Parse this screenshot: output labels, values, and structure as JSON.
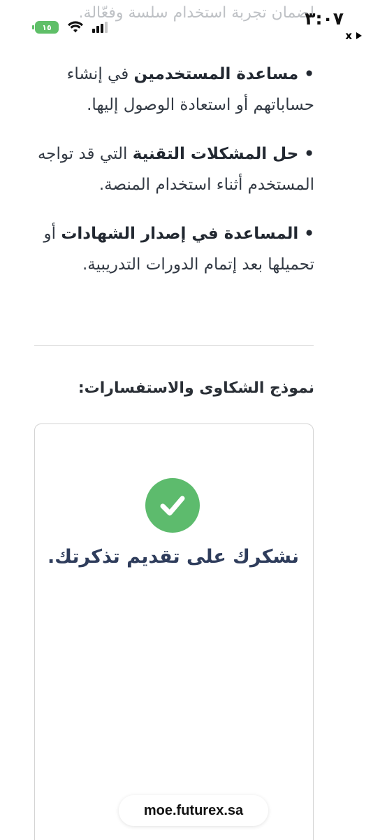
{
  "status_bar": {
    "time": "٣:٠٧",
    "battery": "١٥"
  },
  "overlay": {
    "close_label": "x"
  },
  "top_partial_text": "لضمان تجربة استخدام سلسة وفعّالة.",
  "bullets": [
    {
      "bold": "• مساعدة المستخدمين",
      "rest": " في إنشاء حساباتهم أو استعادة الوصول إليها."
    },
    {
      "bold": "• حل المشكلات التقنية",
      "rest": " التي قد تواجه المستخدم أثناء استخدام المنصة."
    },
    {
      "bold": "• المساعدة في إصدار الشهادات",
      "rest": " أو تحميلها بعد إتمام الدورات التدريبية."
    }
  ],
  "form": {
    "heading": "نموذج الشكاوى والاستفسارات:",
    "success_message": "نشكرك على تقديم تذكرتك."
  },
  "url_bar": {
    "domain": "moe.futurex.sa"
  },
  "colors": {
    "success_green": "#5dbb6d",
    "thanks_text": "#2f3d5c",
    "battery_green": "#5fbf68"
  }
}
